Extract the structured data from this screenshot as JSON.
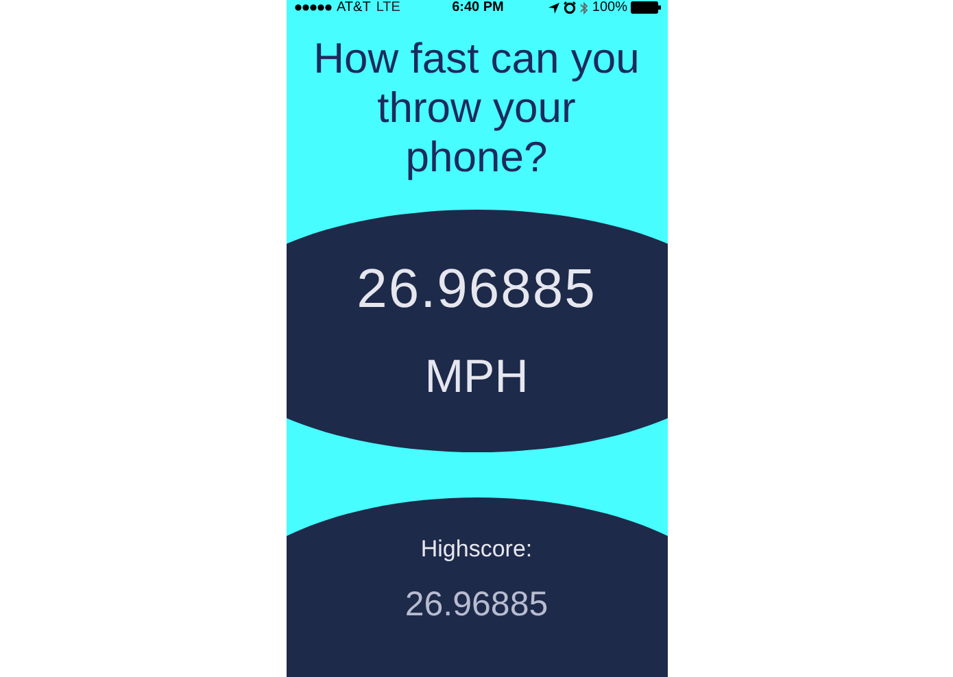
{
  "status_bar": {
    "carrier": "AT&T",
    "network": "LTE",
    "time": "6:40 PM",
    "battery": "100%"
  },
  "title": "How fast can you throw your phone?",
  "speed": {
    "value": "26.96885",
    "unit": "MPH"
  },
  "highscore": {
    "label": "Highscore:",
    "value": "26.96885"
  }
}
